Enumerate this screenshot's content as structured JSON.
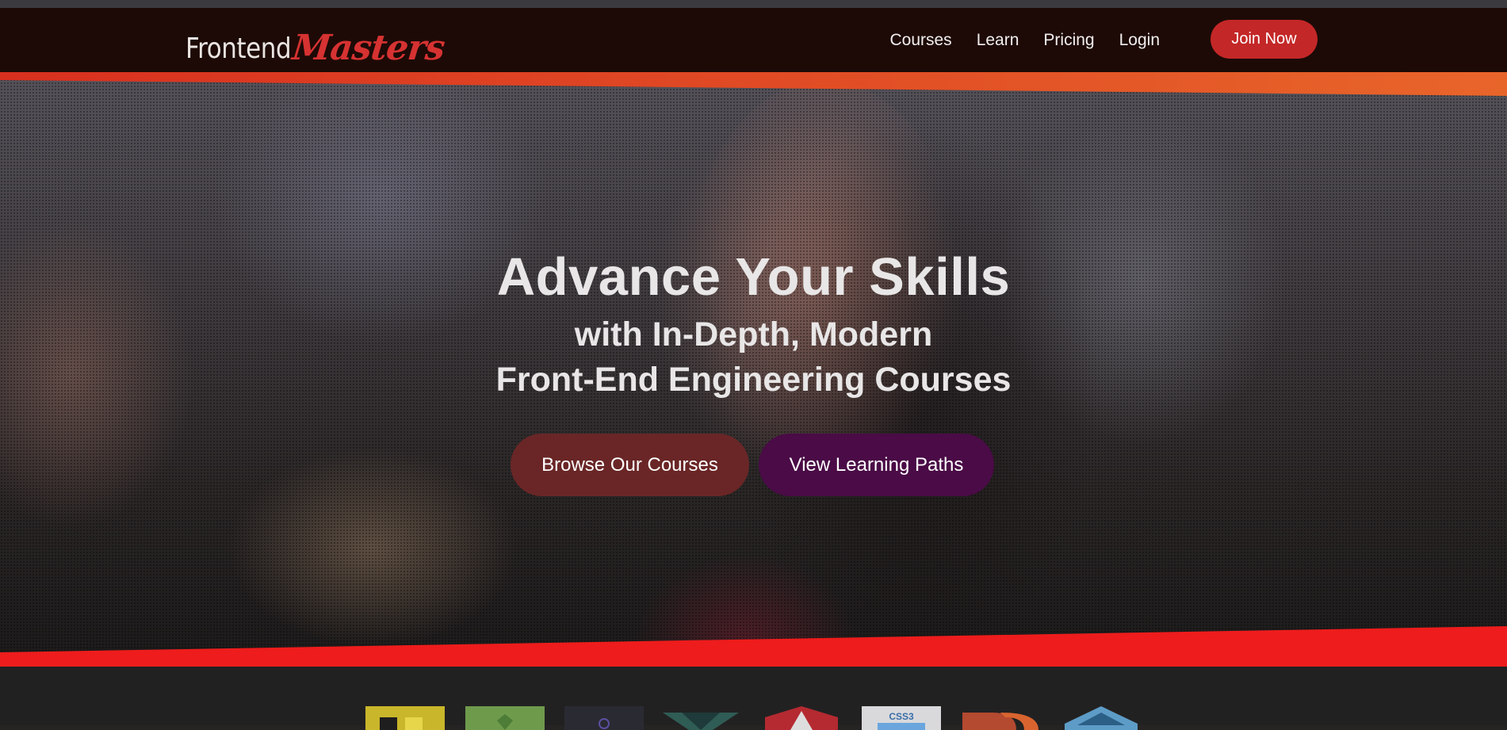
{
  "brand": {
    "name_part1": "Frontend",
    "name_part2": "Masters",
    "primary_red": "#c42727",
    "header_bg": "#1d0a06",
    "accent_orange": "#e35a25",
    "accent_red": "#ee1c1c"
  },
  "nav": {
    "items": [
      {
        "label": "Courses"
      },
      {
        "label": "Learn"
      },
      {
        "label": "Pricing"
      },
      {
        "label": "Login"
      }
    ],
    "cta_label": "Join Now"
  },
  "hero": {
    "title": "Advance Your Skills",
    "subtitle_line1": "with In-Depth, Modern",
    "subtitle_line2": "Front-End Engineering Courses",
    "browse_button": "Browse Our Courses",
    "paths_button": "View Learning Paths",
    "browse_color": "#6a2626",
    "paths_color": "#4a0b46"
  },
  "tech_logos": [
    {
      "icon": "javascript-logo-icon"
    },
    {
      "icon": "nodejs-logo-icon"
    },
    {
      "icon": "webpack-logo-icon"
    },
    {
      "icon": "vue-logo-icon"
    },
    {
      "icon": "angular-logo-icon"
    },
    {
      "icon": "css3-logo-icon"
    },
    {
      "icon": "d3-logo-icon"
    },
    {
      "icon": "webgl-logo-icon"
    }
  ]
}
